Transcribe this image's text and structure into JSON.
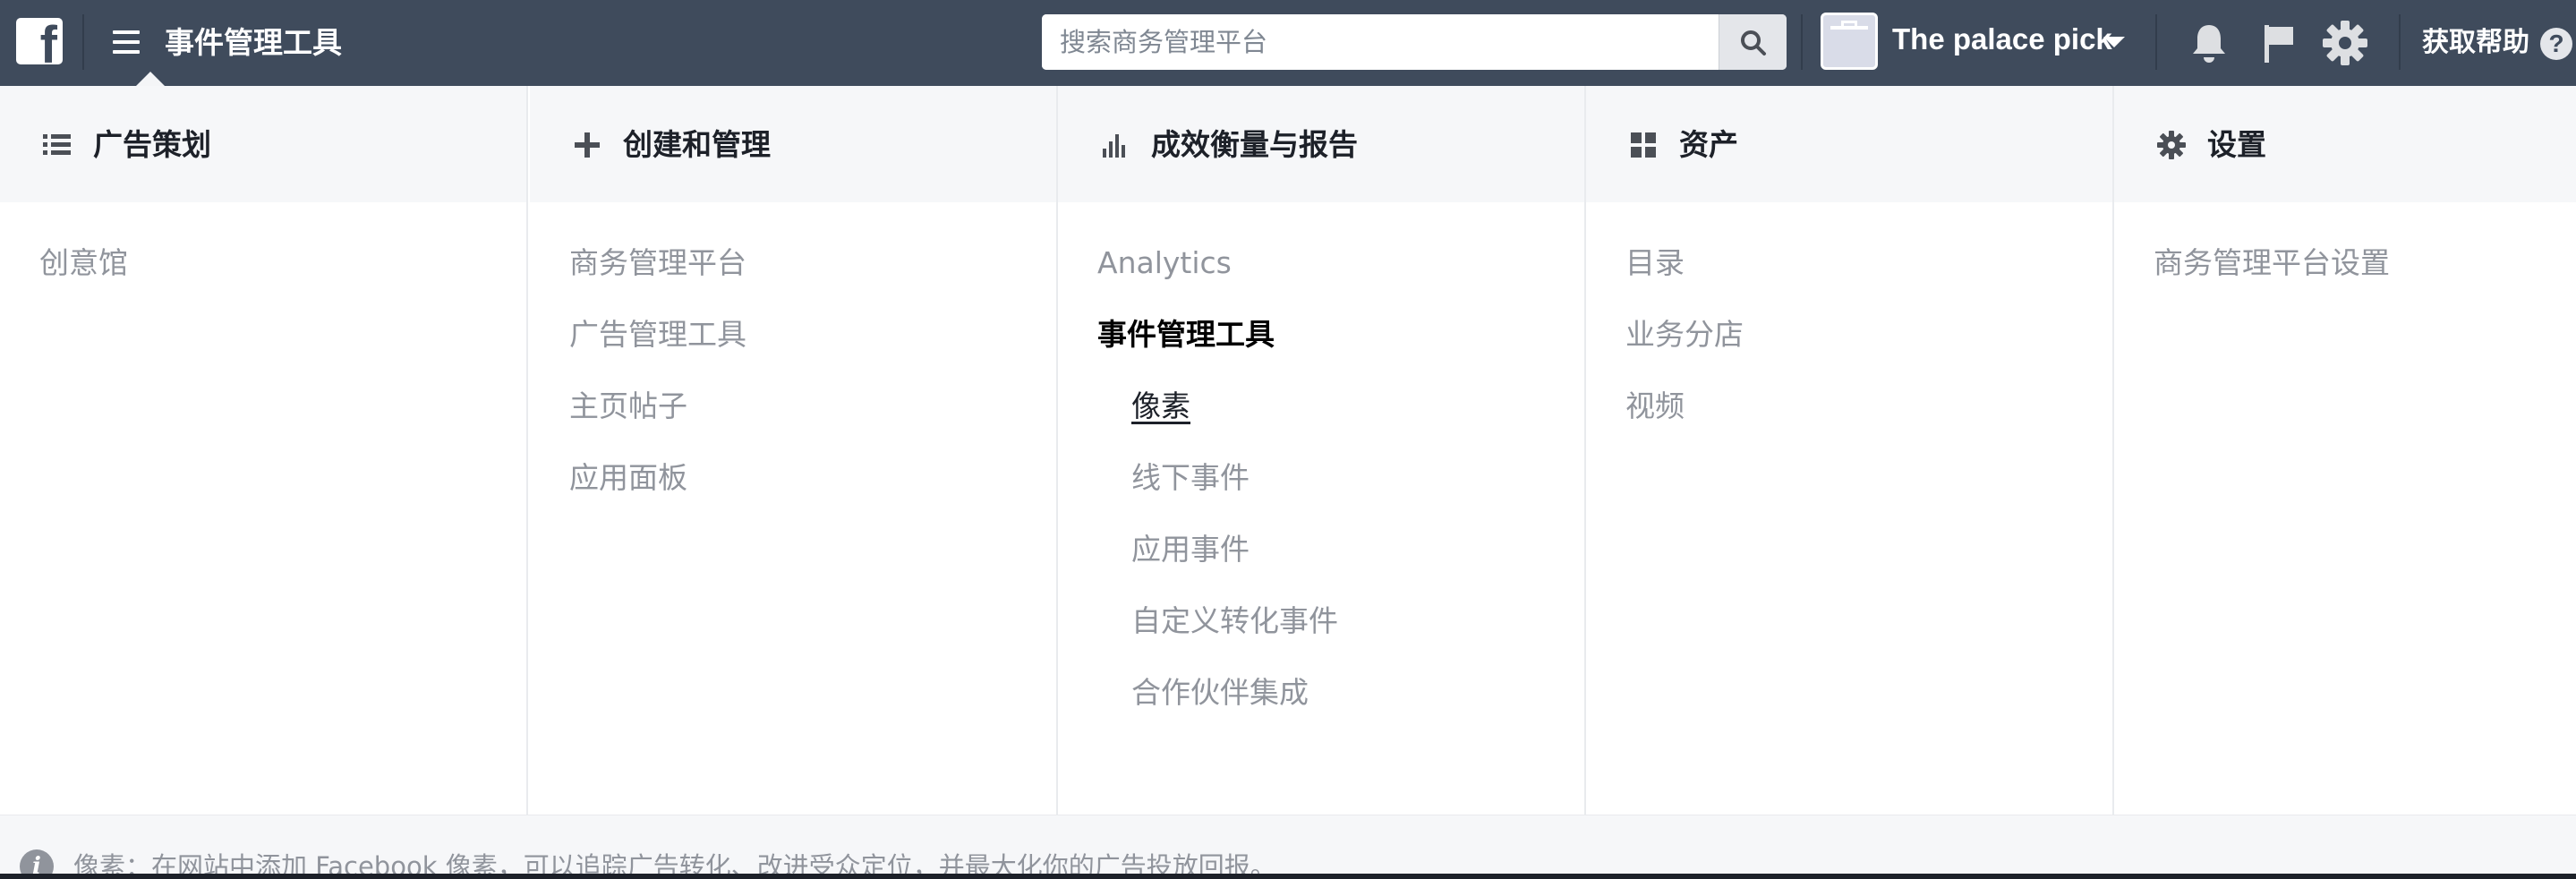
{
  "topbar": {
    "logo_glyph": "f",
    "app_title": "事件管理工具",
    "search": {
      "placeholder": "搜索商务管理平台",
      "value": ""
    },
    "business_name": "The palace pick",
    "help_label": "获取帮助",
    "help_glyph": "?",
    "icons": [
      "facebook-logo-icon",
      "hamburger-menu-icon",
      "search-icon",
      "bell-icon",
      "flag-icon",
      "gear-icon",
      "help-icon"
    ]
  },
  "menu": {
    "columns": [
      {
        "icon": "list-icon",
        "title": "广告策划",
        "items": [
          "创意馆"
        ]
      },
      {
        "icon": "plus-icon",
        "title": "创建和管理",
        "items": [
          "商务管理平台",
          "广告管理工具",
          "主页帖子",
          "应用面板"
        ]
      },
      {
        "icon": "bar-chart-icon",
        "title": "成效衡量与报告",
        "items": [
          "Analytics",
          "事件管理工具",
          "像素",
          "线下事件",
          "应用事件",
          "自定义转化事件",
          "合作伙伴集成"
        ],
        "active_item": "事件管理工具",
        "current_item": "像素"
      },
      {
        "icon": "grid-icon",
        "title": "资产",
        "items": [
          "目录",
          "业务分店",
          "视频"
        ]
      },
      {
        "icon": "settings-icon",
        "title": "设置",
        "items": [
          "商务管理平台设置"
        ]
      }
    ]
  },
  "footer": {
    "info_glyph": "i",
    "text": "像素：在网站中添加 Facebook 像素，可以追踪广告转化、改进受众定位，并最大化你的广告投放回报。"
  },
  "colors": {
    "topbar_bg": "#3f4b5c",
    "header_bg": "#f6f7f9",
    "muted_text": "#90949c",
    "active_text": "#000000"
  }
}
